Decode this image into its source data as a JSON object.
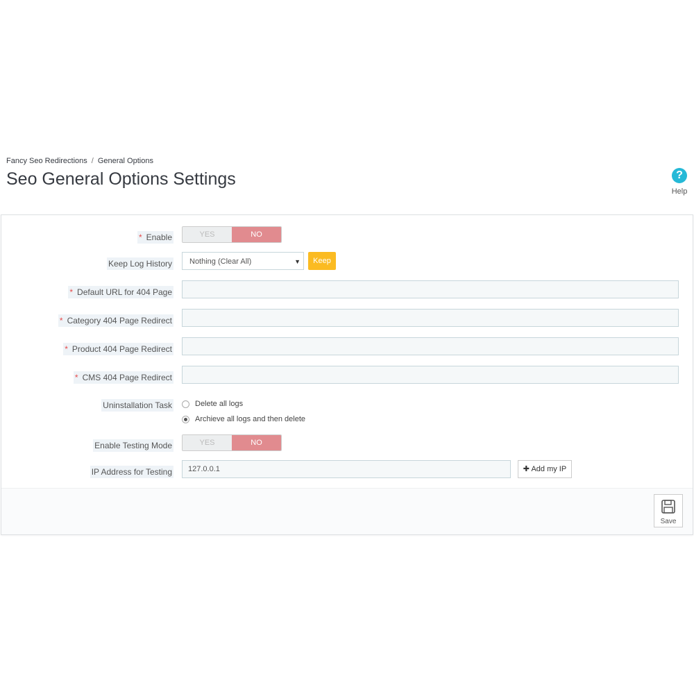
{
  "breadcrumb": {
    "parent": "Fancy Seo Redirections",
    "current": "General Options"
  },
  "page_title": "Seo General Options Settings",
  "help": {
    "label": "Help",
    "icon": "question-circle-icon"
  },
  "form": {
    "enable": {
      "label": "Enable",
      "required": "*",
      "yes": "YES",
      "no": "NO",
      "value": "NO"
    },
    "keep_log": {
      "label": "Keep Log History",
      "selected": "Nothing (Clear All)",
      "button": "Keep"
    },
    "default_url": {
      "label": "Default URL for 404 Page",
      "required": "*",
      "value": ""
    },
    "category_redirect": {
      "label": "Category 404 Page Redirect",
      "required": "*",
      "value": ""
    },
    "product_redirect": {
      "label": "Product 404 Page Redirect",
      "required": "*",
      "value": ""
    },
    "cms_redirect": {
      "label": "CMS 404 Page Redirect",
      "required": "*",
      "value": ""
    },
    "uninstall": {
      "label": "Uninstallation Task",
      "options": [
        "Delete all logs",
        "Archieve all logs and then delete"
      ],
      "selected": "Archieve all logs and then delete"
    },
    "testing_mode": {
      "label": "Enable Testing Mode",
      "yes": "YES",
      "no": "NO",
      "value": "NO"
    },
    "ip_address": {
      "label": "IP Address for Testing",
      "value": "127.0.0.1",
      "button": "Add my IP"
    }
  },
  "save": {
    "label": "Save",
    "icon": "floppy-disk-icon"
  },
  "colors": {
    "accent": "#25b9d7",
    "switch_no": "#e18b8f",
    "keep_button": "#fbbb22",
    "required": "#e64b4b"
  }
}
